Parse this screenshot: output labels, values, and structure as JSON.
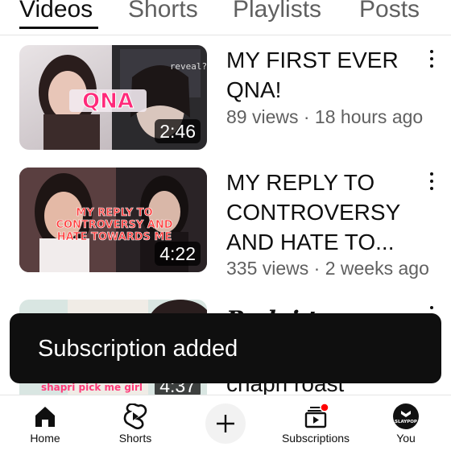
{
  "tabs": [
    {
      "label": "Videos",
      "active": true
    },
    {
      "label": "Shorts",
      "active": false
    },
    {
      "label": "Playlists",
      "active": false
    },
    {
      "label": "Posts",
      "active": false
    }
  ],
  "videos": [
    {
      "title": "MY FIRST EVER\nQNA!",
      "meta": "89 views · 18 hours ago",
      "duration": "2:46",
      "thumb_text": "QNA",
      "thumb_corner_text": "reveal?"
    },
    {
      "title": "MY REPLY TO\nCONTROVERSY\nAND HATE TO...",
      "meta": "335 views · 2 weeks ago",
      "duration": "4:22",
      "thumb_text_lines": [
        "MY REPLY TO",
        "CONTROVERSY AND",
        "HATE TOWARDS ME"
      ]
    },
    {
      "duration": "4:37",
      "thumb_text": "shapri pick me girl",
      "title_partial_top": "Pu lai t",
      "title_partial_bottom": "chapri roast"
    }
  ],
  "snackbar": {
    "text": "Subscription added"
  },
  "bottom_nav": [
    {
      "label": "Home",
      "icon": "home-icon"
    },
    {
      "label": "Shorts",
      "icon": "shorts-icon"
    },
    {
      "label": "",
      "icon": "plus-icon"
    },
    {
      "label": "Subscriptions",
      "icon": "subscriptions-icon",
      "badge_color": "#ff0000"
    },
    {
      "label": "You",
      "icon": "avatar",
      "avatar_text": "SLAYPOP"
    }
  ],
  "colors": {
    "text_primary": "#0f0f0f",
    "text_secondary": "#606060",
    "snackbar_bg": "#0f0f0f",
    "notification_dot": "#ff0000"
  }
}
